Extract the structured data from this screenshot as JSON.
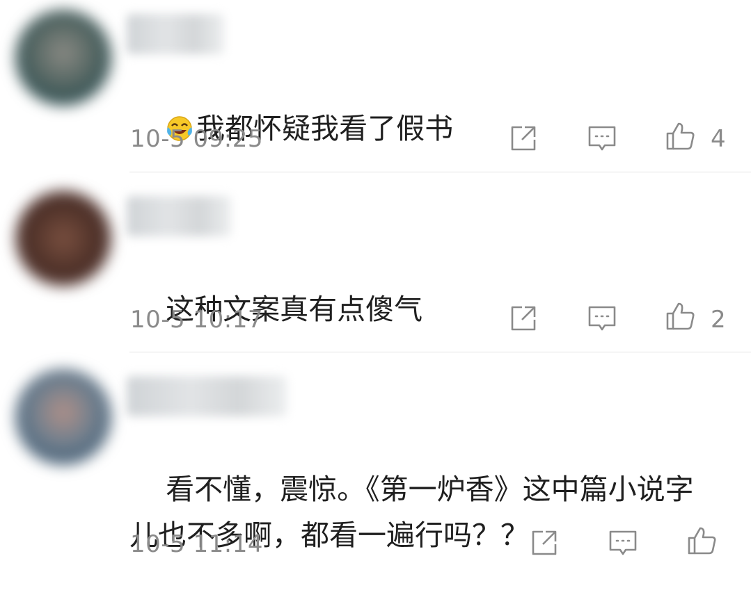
{
  "comments": [
    {
      "text": "我都怀疑我看了假书",
      "emoji": "laughing-tears-emoji",
      "time": "10-5 09:25",
      "likes": "4",
      "avatar_color": "#3e5a5c"
    },
    {
      "text": "这种文案真有点傻气",
      "time": "10-5 10:17",
      "likes": "2",
      "avatar_color": "#5a3a2e"
    },
    {
      "text": "看不懂，震惊。《第一炉香》这中篇小说字\n儿也不多啊，都看一遍行吗？？",
      "time": "10-5 11:14",
      "likes": "",
      "avatar_color": "#4f6478"
    }
  ],
  "icons": {
    "share": "share-icon",
    "reply": "comment-icon",
    "like": "thumbs-up-icon"
  }
}
